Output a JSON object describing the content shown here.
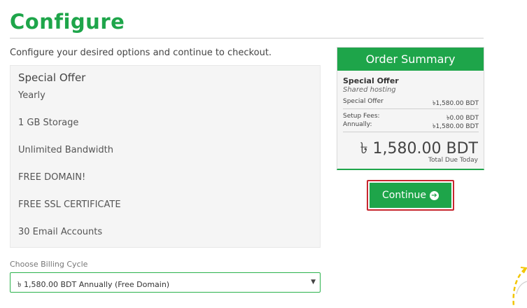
{
  "page": {
    "title": "Configure",
    "intro": "Configure your desired options and continue to checkout."
  },
  "product": {
    "name": "Special Offer",
    "features": [
      "Yearly",
      "1 GB Storage",
      "Unlimited Bandwidth",
      "FREE DOMAIN!",
      "FREE SSL CERTIFICATE",
      "30 Email Accounts"
    ]
  },
  "billing": {
    "label": "Choose Billing Cycle",
    "selected": "৳ 1,580.00 BDT Annually (Free Domain)",
    "caret": "▼"
  },
  "summary": {
    "header": "Order Summary",
    "product_name": "Special Offer",
    "product_group": "Shared hosting",
    "line_item_label": "Special Offer",
    "line_item_value": "৳1,580.00 BDT",
    "setup_label": "Setup Fees:",
    "setup_value": "৳0.00 BDT",
    "annual_label": "Annually:",
    "annual_value": "৳1,580.00 BDT",
    "total": "৳ 1,580.00 BDT",
    "total_label": "Total Due Today"
  },
  "actions": {
    "continue_label": "Continue",
    "continue_icon": "➔"
  },
  "colors": {
    "accent": "#1ea54a",
    "highlight_border": "#c7262e"
  }
}
